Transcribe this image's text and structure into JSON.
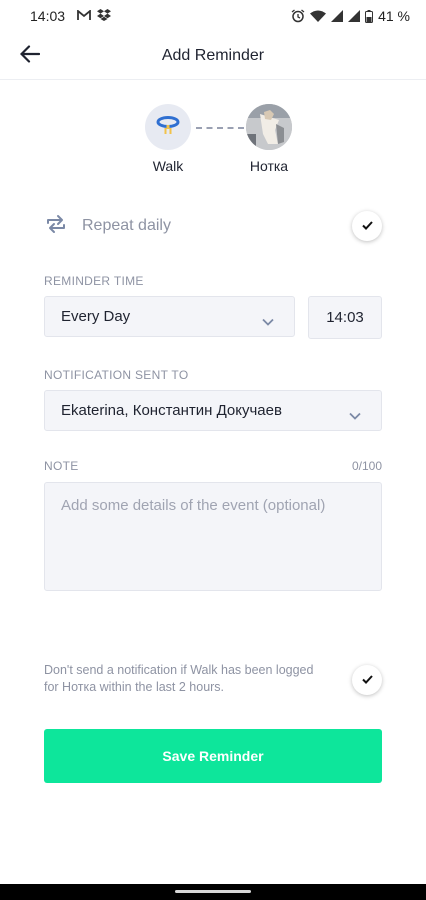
{
  "status_bar": {
    "time": "14:03",
    "left_icons": [
      "gmail-icon",
      "dropbox-icon"
    ],
    "right_icons": [
      "alarm-icon",
      "wifi-icon",
      "signal-icon",
      "signal-icon",
      "battery-icon"
    ],
    "battery": "41 %"
  },
  "app_bar": {
    "title": "Add Reminder",
    "back_icon": "arrow-left-icon"
  },
  "association": {
    "activity_label": "Walk",
    "pet_label": "Нотка"
  },
  "repeat": {
    "label": "Repeat daily",
    "checked": true
  },
  "reminder_time": {
    "label": "REMINDER TIME",
    "frequency": "Every Day",
    "time": "14:03"
  },
  "notification": {
    "label": "NOTIFICATION SENT TO",
    "recipients": "Ekaterina, Константин Докучаев"
  },
  "note": {
    "label": "NOTE",
    "counter": "0/100",
    "placeholder": "Add some details of the event (optional)"
  },
  "dont_send": {
    "text": "Don't send a notification if Walk has been logged for Нотка within the last 2 hours.",
    "checked": true
  },
  "actions": {
    "save_label": "Save Reminder"
  },
  "colors": {
    "accent": "#0de69b",
    "muted_text": "#8e93a3",
    "field_bg": "#f4f5f9"
  }
}
